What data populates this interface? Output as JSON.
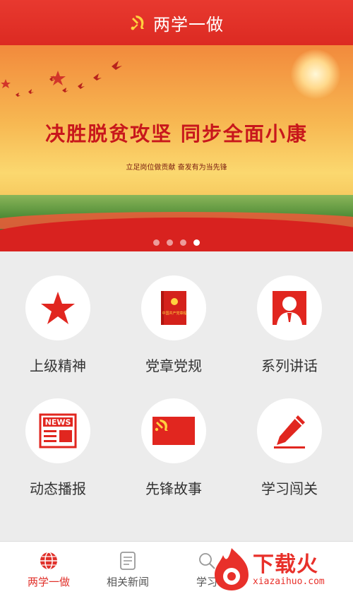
{
  "header": {
    "title": "两学一做",
    "emblem_icon": "party-emblem-icon"
  },
  "banner": {
    "slogan": "决胜脱贫攻坚  同步全面小康",
    "subtitle": "立足岗位做贡献  奋发有为当先锋",
    "slide_count": 4,
    "active_slide": 4
  },
  "grid": [
    {
      "label": "上级精神",
      "icon": "star-icon"
    },
    {
      "label": "党章党规",
      "icon": "party-book-icon",
      "book_text": "中国共产党章程"
    },
    {
      "label": "系列讲话",
      "icon": "speaker-person-icon"
    },
    {
      "label": "动态播报",
      "icon": "news-icon",
      "news_text": "NEWS"
    },
    {
      "label": "先锋故事",
      "icon": "party-flag-icon"
    },
    {
      "label": "学习闯关",
      "icon": "pencil-icon"
    }
  ],
  "tabs": [
    {
      "label": "两学一做",
      "icon": "globe-icon",
      "active": true
    },
    {
      "label": "相关新闻",
      "icon": "document-icon",
      "active": false
    },
    {
      "label": "学习",
      "icon": "search-icon",
      "active": false
    }
  ],
  "watermark": {
    "title": "下载火",
    "url": "xiazaihuo.com"
  },
  "colors": {
    "primary": "#e0302a",
    "background": "#ececec"
  }
}
